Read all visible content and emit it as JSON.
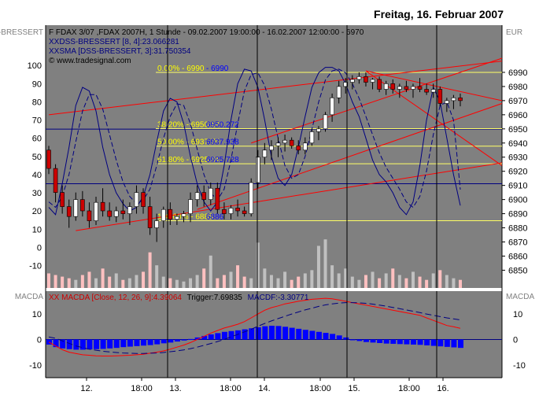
{
  "header": {
    "date": "Freitag, 16. Februar 2007"
  },
  "colors": {
    "plot_bg": "#808080",
    "up_candle": "#ffffff",
    "down_candle": "#cc0000",
    "trend": "#ff0000",
    "dss": "#000080",
    "fib_line": "#ffff66",
    "fib_text": "#ffff00",
    "volume": "#c0c0c0",
    "volume_down": "#ffc0c0",
    "macd": "#ff0000",
    "trigger": "#000080",
    "hist": "#0000ff",
    "separator": "#ffffff",
    "grid": "#000000"
  },
  "chart_data": [
    {
      "type": "candlestick",
      "panel": "price",
      "title": "F FDAX 3/07 ,FDAX 2007H, 1 Stunde - 09.02.2007 19:00:00 - 16.02.2007 12:00:00 - 6970",
      "indicators": [
        {
          "label": "DSS-BRESSERT [8, 4]:23.066281",
          "style": "solid",
          "color": "#000080"
        },
        {
          "label": "SMA [DSS-BRESSERT, 3]:31.750354",
          "style": "dashed",
          "color": "#000080"
        }
      ],
      "watermark": "© www.tradesignal.com",
      "left_axis_label": "-BRESSERT",
      "right_axis_label": "EUR",
      "left_ticks": [
        "100",
        "90",
        "80",
        "70",
        "60",
        "50",
        "40",
        "30",
        "20",
        "10",
        "0",
        "-10"
      ],
      "right_ticks": [
        "6990",
        "6980",
        "6970",
        "6960",
        "6950",
        "6940",
        "6930",
        "6920",
        "6910",
        "6900",
        "6890",
        "6880",
        "6870",
        "6860",
        "6850"
      ],
      "ylim_price": [
        6843,
        7000
      ],
      "ylim_osc": [
        -18,
        104
      ],
      "x_ticks": [
        "12.",
        "18:00",
        "13.",
        "18:00",
        "14.",
        "18:00",
        "15.",
        "18:00",
        "16."
      ],
      "fib_levels": [
        {
          "label": "0.00% - 6990",
          "price": 6990
        },
        {
          "label": "38.20% - 6950.19",
          "price": 6950.2
        },
        {
          "label": "50.00% - 6937.75",
          "price": 6937.8
        },
        {
          "label": "61.80% - 6925.31",
          "price": 6925.3
        },
        {
          "label": "100.00% - 6885",
          "price": 6885
        }
      ],
      "fib_labels_right": [
        "- 6990",
        "6950.272",
        "6937.938",
        "6925.728",
        "6886"
      ],
      "candles": [
        [
          6935,
          6938,
          6918,
          6922
        ],
        [
          6922,
          6925,
          6898,
          6905
        ],
        [
          6905,
          6910,
          6890,
          6895
        ],
        [
          6895,
          6900,
          6880,
          6888
        ],
        [
          6888,
          6905,
          6885,
          6900
        ],
        [
          6900,
          6906,
          6888,
          6892
        ],
        [
          6892,
          6898,
          6880,
          6885
        ],
        [
          6885,
          6902,
          6882,
          6898
        ],
        [
          6898,
          6908,
          6888,
          6892
        ],
        [
          6892,
          6898,
          6885,
          6888
        ],
        [
          6888,
          6895,
          6884,
          6892
        ],
        [
          6892,
          6900,
          6886,
          6890
        ],
        [
          6890,
          6898,
          6882,
          6895
        ],
        [
          6895,
          6910,
          6890,
          6905
        ],
        [
          6905,
          6908,
          6890,
          6895
        ],
        [
          6895,
          6902,
          6875,
          6880
        ],
        [
          6880,
          6890,
          6870,
          6885
        ],
        [
          6885,
          6895,
          6880,
          6893
        ],
        [
          6893,
          6898,
          6882,
          6886
        ],
        [
          6886,
          6890,
          6882,
          6888
        ],
        [
          6888,
          6892,
          6884,
          6890
        ],
        [
          6890,
          6905,
          6884,
          6900
        ],
        [
          6900,
          6910,
          6895,
          6905
        ],
        [
          6905,
          6910,
          6895,
          6900
        ],
        [
          6900,
          6912,
          6896,
          6908
        ],
        [
          6908,
          6912,
          6890,
          6893
        ],
        [
          6893,
          6898,
          6886,
          6890
        ],
        [
          6890,
          6896,
          6886,
          6894
        ],
        [
          6894,
          6900,
          6888,
          6892
        ],
        [
          6892,
          6895,
          6888,
          6890
        ],
        [
          6890,
          6915,
          6888,
          6912
        ],
        [
          6912,
          6935,
          6908,
          6930
        ],
        [
          6930,
          6940,
          6925,
          6935
        ],
        [
          6935,
          6942,
          6928,
          6938
        ],
        [
          6938,
          6944,
          6930,
          6940
        ],
        [
          6940,
          6946,
          6934,
          6942
        ],
        [
          6942,
          6944,
          6936,
          6938
        ],
        [
          6938,
          6942,
          6932,
          6935
        ],
        [
          6935,
          6944,
          6932,
          6940
        ],
        [
          6940,
          6950,
          6938,
          6948
        ],
        [
          6948,
          6952,
          6942,
          6950
        ],
        [
          6950,
          6962,
          6948,
          6960
        ],
        [
          6960,
          6975,
          6955,
          6972
        ],
        [
          6972,
          6984,
          6968,
          6980
        ],
        [
          6980,
          6986,
          6975,
          6983
        ],
        [
          6983,
          6988,
          6978,
          6985
        ],
        [
          6985,
          6990,
          6982,
          6987
        ],
        [
          6987,
          6990,
          6980,
          6983
        ],
        [
          6983,
          6986,
          6978,
          6985
        ],
        [
          6985,
          6987,
          6976,
          6978
        ],
        [
          6978,
          6984,
          6974,
          6982
        ],
        [
          6982,
          6985,
          6975,
          6978
        ],
        [
          6978,
          6982,
          6972,
          6980
        ],
        [
          6980,
          6984,
          6976,
          6978
        ],
        [
          6978,
          6982,
          6972,
          6980
        ],
        [
          6980,
          6986,
          6976,
          6978
        ],
        [
          6978,
          6982,
          6974,
          6976
        ],
        [
          6976,
          6982,
          6972,
          6978
        ],
        [
          6978,
          6980,
          6966,
          6968
        ],
        [
          6968,
          6972,
          6962,
          6970
        ],
        [
          6970,
          6974,
          6964,
          6972
        ],
        [
          6972,
          6975,
          6966,
          6970
        ]
      ],
      "dss": [
        22,
        18,
        35,
        55,
        78,
        88,
        86,
        75,
        55,
        40,
        30,
        24,
        20,
        22,
        28,
        40,
        58,
        75,
        82,
        80,
        68,
        50,
        35,
        25,
        20,
        25,
        45,
        70,
        90,
        98,
        97,
        88,
        70,
        50,
        38,
        34,
        40,
        55,
        72,
        88,
        96,
        99,
        99,
        97,
        90,
        80,
        72,
        60,
        48,
        40,
        36,
        30,
        22,
        18,
        25,
        45,
        70,
        88,
        80,
        60,
        40,
        23
      ],
      "sma": [
        25,
        22,
        28,
        40,
        58,
        75,
        84,
        84,
        76,
        62,
        48,
        36,
        28,
        24,
        26,
        32,
        45,
        60,
        72,
        79,
        78,
        68,
        54,
        40,
        30,
        26,
        32,
        48,
        68,
        86,
        95,
        96,
        89,
        76,
        60,
        45,
        38,
        40,
        50,
        65,
        80,
        92,
        97,
        98,
        96,
        90,
        82,
        72,
        62,
        52,
        44,
        38,
        32,
        25,
        22,
        28,
        42,
        62,
        78,
        80,
        70,
        31.75
      ],
      "volume": [
        9,
        8,
        7,
        6,
        5,
        8,
        10,
        6,
        12,
        7,
        9,
        5,
        6,
        8,
        10,
        22,
        14,
        7,
        6,
        5,
        4,
        6,
        8,
        12,
        20,
        6,
        8,
        10,
        14,
        7,
        6,
        28,
        12,
        8,
        6,
        10,
        5,
        7,
        9,
        11,
        26,
        30,
        14,
        9,
        12,
        7,
        5,
        8,
        10,
        6,
        9,
        12,
        8,
        6,
        10,
        7,
        5,
        9,
        11,
        8,
        6,
        5
      ],
      "trend_lines": [
        {
          "from": [
            0,
            6960
          ],
          "to": [
            75,
            6998
          ]
        },
        {
          "from": [
            4,
            6878
          ],
          "to": [
            75,
            6926
          ]
        },
        {
          "from": [
            22,
            6893
          ],
          "to": [
            75,
            6968
          ]
        },
        {
          "from": [
            47,
            6991
          ],
          "to": [
            75,
            6970
          ]
        },
        {
          "from": [
            47,
            6991
          ],
          "to": [
            75,
            6924
          ]
        },
        {
          "from": [
            30,
            6940
          ],
          "to": [
            75,
            7000
          ]
        }
      ]
    },
    {
      "type": "line",
      "panel": "macd",
      "left_axis_label": "MACDA",
      "right_axis_label": "MACDA",
      "title": "MACDA [Close, 12, 26, 9]:4.39064",
      "trigger_label": "Trigger:7.69835",
      "macdf_label": "MACDF:-3.30771",
      "ticks": [
        "10",
        "0",
        "-10"
      ],
      "ylim": [
        -15,
        19
      ],
      "series": [
        {
          "name": "MACDA",
          "values": [
            -1,
            -2.5,
            -4,
            -5,
            -5.5,
            -6,
            -6.2,
            -6.4,
            -6.5,
            -6.5,
            -6.4,
            -6.3,
            -6.2,
            -6,
            -5.8,
            -5.4,
            -5,
            -4.5,
            -3.8,
            -3,
            -2.2,
            -1.2,
            0,
            1.2,
            2.5,
            3.5,
            4.5,
            5.2,
            6,
            7,
            8.5,
            10,
            11.5,
            12.5,
            13.2,
            14,
            14.5,
            15,
            15.4,
            15.8,
            16,
            16.2,
            16,
            15.5,
            15,
            14.5,
            14,
            13.5,
            13,
            12.5,
            12,
            11.5,
            11,
            10.5,
            10,
            9.5,
            8.5,
            7.5,
            6.5,
            5.5,
            5,
            4.4
          ]
        },
        {
          "name": "Trigger",
          "values": [
            1,
            0.5,
            -0.5,
            -1.5,
            -2.5,
            -3.2,
            -3.8,
            -4.2,
            -4.6,
            -4.9,
            -5.1,
            -5.3,
            -5.4,
            -5.5,
            -5.5,
            -5.4,
            -5.3,
            -5.1,
            -4.8,
            -4.5,
            -4.1,
            -3.6,
            -3,
            -2.3,
            -1.6,
            -0.8,
            0,
            1,
            2,
            3,
            4,
            5.2,
            6.3,
            7.3,
            8.2,
            9.1,
            10,
            10.8,
            11.6,
            12.3,
            13,
            13.6,
            14,
            14.3,
            14.5,
            14.5,
            14.4,
            14.2,
            13.9,
            13.5,
            13.1,
            12.6,
            12.1,
            11.6,
            11.1,
            10.6,
            10,
            9.5,
            9,
            8.5,
            8.1,
            7.7
          ]
        },
        {
          "name": "MACDF",
          "values": [
            -2,
            -3,
            -3.5,
            -3.8,
            -4,
            -4,
            -3.9,
            -3.8,
            -3.7,
            -3.5,
            -3.3,
            -3,
            -2.8,
            -2.6,
            -2.4,
            -2.2,
            -1.9,
            -1.5,
            -1.2,
            -0.8,
            -0.4,
            0.2,
            0.8,
            1.4,
            2,
            2.5,
            3,
            3.3,
            3.6,
            4,
            4.4,
            4.8,
            5.2,
            5.4,
            5.3,
            5,
            4.6,
            4.2,
            3.8,
            3.4,
            3,
            2.6,
            2.2,
            1.6,
            0.8,
            0,
            -0.6,
            -1,
            -1.2,
            -1.4,
            -1.6,
            -1.7,
            -1.8,
            -1.9,
            -2,
            -2.1,
            -2.3,
            -2.5,
            -2.7,
            -2.9,
            -3.1,
            -3.3
          ]
        }
      ]
    }
  ]
}
